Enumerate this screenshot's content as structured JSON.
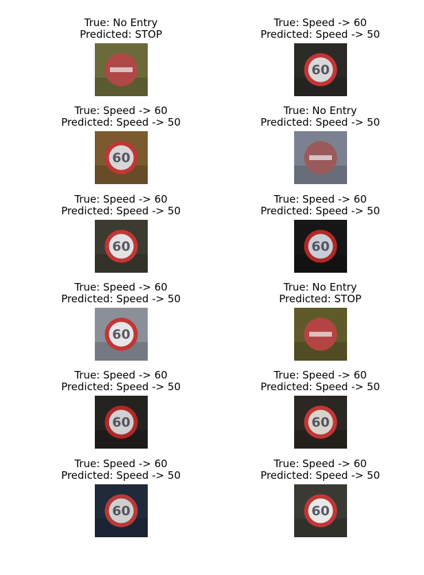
{
  "panels": [
    {
      "true_label": "True: No Entry",
      "predicted_label": "Predicted: STOP",
      "sign": "no-entry",
      "bg": "#6b6a3a",
      "ring": "#b63a3a",
      "fill": "#b04848",
      "text": ""
    },
    {
      "true_label": "True: Speed -> 60",
      "predicted_label": "Predicted: Speed -> 50",
      "sign": "speed",
      "bg": "#2c2a26",
      "ring": "#c23636",
      "fill": "#d9d9d9",
      "text": "60"
    },
    {
      "true_label": "True: Speed -> 60",
      "predicted_label": "Predicted: Speed -> 50",
      "sign": "speed",
      "bg": "#7a5a2e",
      "ring": "#c23636",
      "fill": "#d6d6d6",
      "text": "60"
    },
    {
      "true_label": "True: No Entry",
      "predicted_label": "Predicted: Speed -> 50",
      "sign": "no-entry",
      "bg": "#7b8190",
      "ring": "#a34a4a",
      "fill": "#9b5a5a",
      "text": ""
    },
    {
      "true_label": "True: Speed -> 60",
      "predicted_label": "Predicted: Speed -> 50",
      "sign": "speed",
      "bg": "#3d3a30",
      "ring": "#c23636",
      "fill": "#e2e2e2",
      "text": "60"
    },
    {
      "true_label": "True: Speed -> 60",
      "predicted_label": "Predicted: Speed -> 50",
      "sign": "speed",
      "bg": "#161616",
      "ring": "#b02828",
      "fill": "#c9ced6",
      "text": "60"
    },
    {
      "true_label": "True: Speed -> 60",
      "predicted_label": "Predicted: Speed -> 50",
      "sign": "speed",
      "bg": "#8a8f98",
      "ring": "#c23636",
      "fill": "#e6e6e6",
      "text": "60"
    },
    {
      "true_label": "True: No Entry",
      "predicted_label": "Predicted: STOP",
      "sign": "no-entry",
      "bg": "#5f5a2a",
      "ring": "#b63a3a",
      "fill": "#b44444",
      "text": ""
    },
    {
      "true_label": "True: Speed -> 60",
      "predicted_label": "Predicted: Speed -> 50",
      "sign": "speed",
      "bg": "#24221f",
      "ring": "#b02828",
      "fill": "#d0d0d0",
      "text": "60"
    },
    {
      "true_label": "True: Speed -> 60",
      "predicted_label": "Predicted: Speed -> 50",
      "sign": "speed",
      "bg": "#2b2722",
      "ring": "#c23636",
      "fill": "#d8d4cc",
      "text": "60"
    },
    {
      "true_label": "True: Speed -> 60",
      "predicted_label": "Predicted: Speed -> 50",
      "sign": "speed",
      "bg": "#1f2a3a",
      "ring": "#b63a3a",
      "fill": "#cfcfcf",
      "text": "60"
    },
    {
      "true_label": "True: Speed -> 60",
      "predicted_label": "Predicted: Speed -> 50",
      "sign": "speed",
      "bg": "#3a3a34",
      "ring": "#c23636",
      "fill": "#e8e8e8",
      "text": "60"
    }
  ]
}
